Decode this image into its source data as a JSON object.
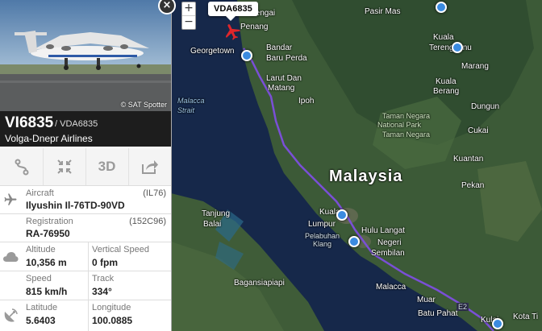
{
  "map": {
    "zoom_in": "+",
    "zoom_out": "−",
    "callout": "VDA6835",
    "labels": {
      "malaysia": "Malaysia",
      "sengai": "Sengai",
      "pasir_mas": "Pasir Mas",
      "penang": "Penang",
      "georgetown": "Georgetown",
      "bandar": "Bandar",
      "baru_perda": "Baru Perda",
      "kuala_terengganu_1": "Kuala",
      "kuala_terengganu_2": "Terengganu",
      "marang": "Marang",
      "larut_dan": "Larut Dan",
      "matang": "Matang",
      "malacca_strait_1": "Malacca",
      "malacca_strait_2": "Strait",
      "ipoh": "Ipoh",
      "kuala_berang_1": "Kuala",
      "kuala_berang_2": "Berang",
      "dungun": "Dungun",
      "park_1": "Taman Negara",
      "park_2": "National Park",
      "park_3": "Taman Negara",
      "cukai": "Cukai",
      "kuantan": "Kuantan",
      "pekan": "Pekan",
      "kuala_lumpur_1": "Kuala",
      "kuala_lumpur_2": "Lumpur",
      "tanjung_balai": "Tanjung",
      "balai": "Balai",
      "pelabuhan_1": "Pelabuhan",
      "pelabuhan_2": "Klang",
      "hulu_langat": "Hulu Langat",
      "negeri_1": "Negeri",
      "negeri_2": "Sembilan",
      "bagansiapiapi": "Bagansiapiapi",
      "malacca": "Malacca",
      "muar": "Muar",
      "batu_pahat": "Batu Pahat",
      "e2": "E2",
      "kulai": "Kulai",
      "kota_tinggi": "Kota Ti"
    }
  },
  "photo": {
    "credit": "© SAT Spotter"
  },
  "close": "×",
  "header": {
    "flight": "VI6835",
    "callsign": "/ VDA6835",
    "airline": "Volga-Dnepr Airlines"
  },
  "tools": {
    "t3d": "3D"
  },
  "details": {
    "aircraft_label": "Aircraft",
    "aircraft_code": "(IL76)",
    "aircraft_value": "Ilyushin Il-76TD-90VD",
    "registration_label": "Registration",
    "registration_code": "(152C96)",
    "registration_value": "RA-76950",
    "altitude_label": "Altitude",
    "altitude_value": "10,356 m",
    "vspeed_label": "Vertical Speed",
    "vspeed_value": "0 fpm",
    "speed_label": "Speed",
    "speed_value": "815 km/h",
    "track_label": "Track",
    "track_value": "334°",
    "latitude_label": "Latitude",
    "latitude_value": "5.6403",
    "longitude_label": "Longitude",
    "longitude_value": "100.0885"
  },
  "colors": {
    "flight_path": "#7a4fd6",
    "header_bg": "#1d1d1d",
    "pin": "#3b8be0",
    "plane": "#e0262b"
  }
}
